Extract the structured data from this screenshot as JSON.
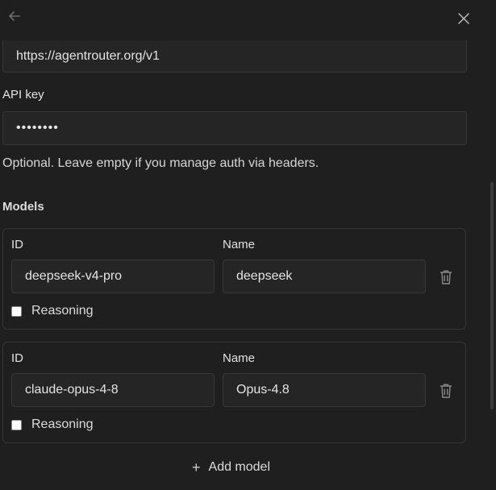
{
  "connection": {
    "base_url_value": "https://agentrouter.org/v1",
    "api_key_label": "API key",
    "api_key_value": "••••••••",
    "api_key_hint": "Optional. Leave empty if you manage auth via headers."
  },
  "models": {
    "heading": "Models",
    "id_label": "ID",
    "name_label": "Name",
    "reasoning_label": "Reasoning",
    "items": [
      {
        "id": "deepseek-v4-pro",
        "name": "deepseek",
        "reasoning": false
      },
      {
        "id": "claude-opus-4-8",
        "name": "Opus-4.8",
        "reasoning": false
      }
    ],
    "add_label": "Add model"
  },
  "icons": {
    "back": "arrow-left-icon",
    "close": "close-icon",
    "delete": "trash-icon",
    "add": "plus-icon"
  },
  "colors": {
    "background": "#1f1f1f",
    "input_background": "#252525",
    "border": "#363636",
    "text": "#e4e4e4"
  }
}
